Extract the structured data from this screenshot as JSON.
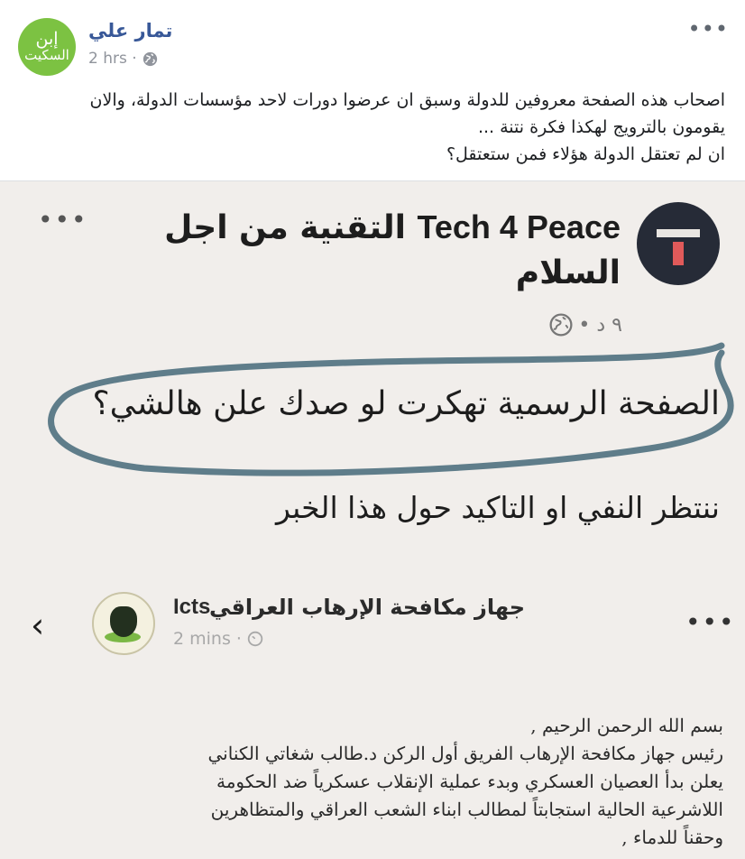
{
  "post": {
    "author": "تمار علي",
    "avatar_text_1": "إبن",
    "avatar_text_2": "السكيت",
    "time": "2 hrs ·",
    "more": "•••",
    "body_lines": [
      "اصحاب هذه الصفحة معروفين للدولة وسبق ان عرضوا دورات لاحد مؤسسات الدولة، والان",
      "يقومون بالترويج لهكذا فكرة نتنة ...",
      "ان لم تعتقل الدولة هؤلاء فمن ستعتقل؟"
    ]
  },
  "shared_post": {
    "page_name_latin": "Tech 4 Peace",
    "page_name_arabic_1": "التقنية من اجل",
    "page_name_arabic_2": "السلام",
    "time": "٩ د •",
    "more": "•••",
    "claim": "الصفحة الرسمية تهكرت لو صدك علن هالشي؟",
    "await": "ننتظر النفي او التاكيد حول هذا الخبر"
  },
  "embedded_post": {
    "back": "‹",
    "page_name": "جهاز مكافحة الإرهاب العراقي",
    "page_name_latin": "Icts",
    "time": "2 mins ·",
    "more": "•••",
    "lines": [
      "بسم الله الرحمن الرحيم ,",
      "رئيس جهاز مكافحة الإرهاب الفريق أول الركن د.طالب شغاتي الكناني",
      "يعلن بدأ العصيان العسكري وبدء عملية الإنقلاب عسكرياً ضد الحكومة",
      "اللاشرعية الحالية استجابتاً لمطالب ابناء الشعب العراقي والمتظاهرين",
      "وحقناً للدماء ,"
    ]
  },
  "colors": {
    "author_link": "#385898",
    "avatar_green": "#7cc242",
    "screenshot_bg": "#f1eeeb",
    "circle_annotation": "#5f7d8a"
  }
}
